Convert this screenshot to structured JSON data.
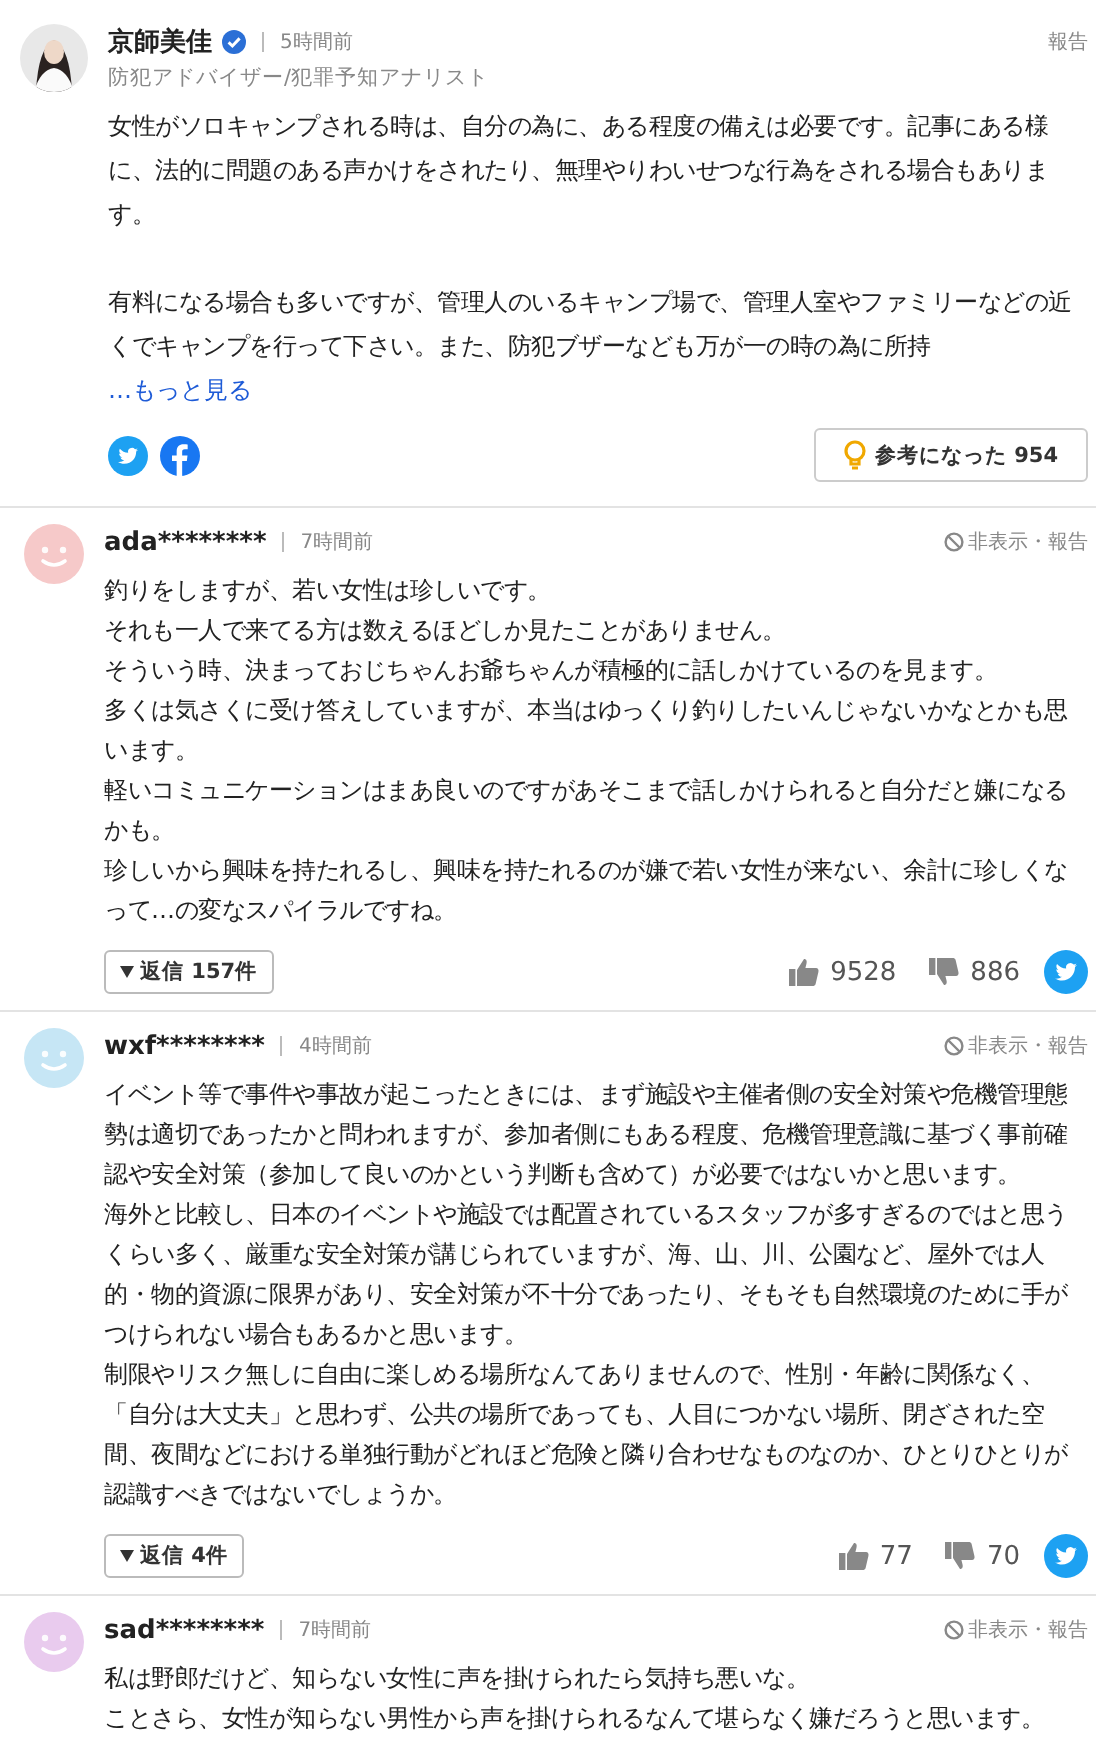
{
  "expert": {
    "name": "京師美佳",
    "time": "5時間前",
    "report": "報告",
    "title": "防犯アドバイザー/犯罪予知アナリスト",
    "paragraphs": [
      "女性がソロキャンプされる時は、自分の為に、ある程度の備えは必要です。記事にある様に、法的に問題のある声かけをされたり、無理やりわいせつな行為をされる場合もあります。",
      "有料になる場合も多いですが、管理人のいるキャンプ場で、管理人室やファミリーなどの近くでキャンプを行って下さい。また、防犯ブザーなども万が一の時の為に所持"
    ],
    "more": "…もっと見る",
    "helpful": "参考になった 954"
  },
  "comments": [
    {
      "user": "ada********",
      "time": "7時間前",
      "color": "#f6c9c9",
      "actions": "非表示・報告",
      "body": [
        "釣りをしますが、若い女性は珍しいです。",
        "それも一人で来てる方は数えるほどしか見たことがありません。",
        "そういう時、決まっておじちゃんお爺ちゃんが積極的に話しかけているのを見ます。",
        "多くは気さくに受け答えしていますが、本当はゆっくり釣りしたいんじゃないかなとかも思います。",
        "軽いコミュニケーションはまあ良いのですがあそこまで話しかけられると自分だと嫌になるかも。",
        "珍しいから興味を持たれるし、興味を持たれるのが嫌で若い女性が来ない、余計に珍しくなって…の変なスパイラルですね。"
      ],
      "replies": "返信 157件",
      "likes": "9528",
      "dislikes": "886"
    },
    {
      "user": "wxf********",
      "time": "4時間前",
      "color": "#c6e6f5",
      "actions": "非表示・報告",
      "body": [
        "イベント等で事件や事故が起こったときには、まず施設や主催者側の安全対策や危機管理態勢は適切であったかと問われますが、参加者側にもある程度、危機管理意識に基づく事前確認や安全対策（参加して良いのかという判断も含めて）が必要ではないかと思います。",
        "海外と比較し、日本のイベントや施設では配置されているスタッフが多すぎるのではと思うくらい多く、厳重な安全対策が講じられていますが、海、山、川、公園など、屋外では人的・物的資源に限界があり、安全対策が不十分であったり、そもそも自然環境のために手がつけられない場合もあるかと思います。",
        "制限やリスク無しに自由に楽しめる場所なんてありませんので、性別・年齢に関係なく、「自分は大丈夫」と思わず、公共の場所であっても、人目につかない場所、閉ざされた空間、夜間などにおける単独行動がどれほど危険と隣り合わせなものなのか、ひとりひとりが認識すべきではないでしょうか。"
      ],
      "replies": "返信 4件",
      "likes": "77",
      "dislikes": "70"
    },
    {
      "user": "sad********",
      "time": "7時間前",
      "color": "#e9cbee",
      "actions": "非表示・報告",
      "body": [
        "私は野郎だけど、知らない女性に声を掛けられたら気持ち悪いな。",
        "ことさら、女性が知らない男性から声を掛けられるなんて堪らなく嫌だろうと思います。"
      ]
    }
  ]
}
